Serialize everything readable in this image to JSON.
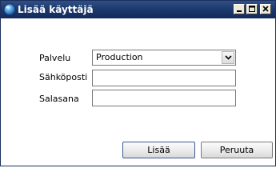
{
  "window": {
    "title": "Lisää käyttäjä"
  },
  "form": {
    "service_label": "Palvelu",
    "service_value": "Production",
    "email_label": "Sähköposti",
    "email_value": "",
    "password_label": "Salasana",
    "password_value": ""
  },
  "buttons": {
    "add_label": "Lisää",
    "cancel_label": "Peruuta"
  },
  "icons": {
    "app": "globe-icon",
    "minimize": "minimize-icon",
    "maximize": "maximize-icon",
    "close": "close-icon",
    "dropdown": "chevron-down-icon"
  },
  "colors": {
    "titlebar": "#1e3a6e",
    "title_text": "#ffffff",
    "default_button_border": "#3c5d8c"
  }
}
